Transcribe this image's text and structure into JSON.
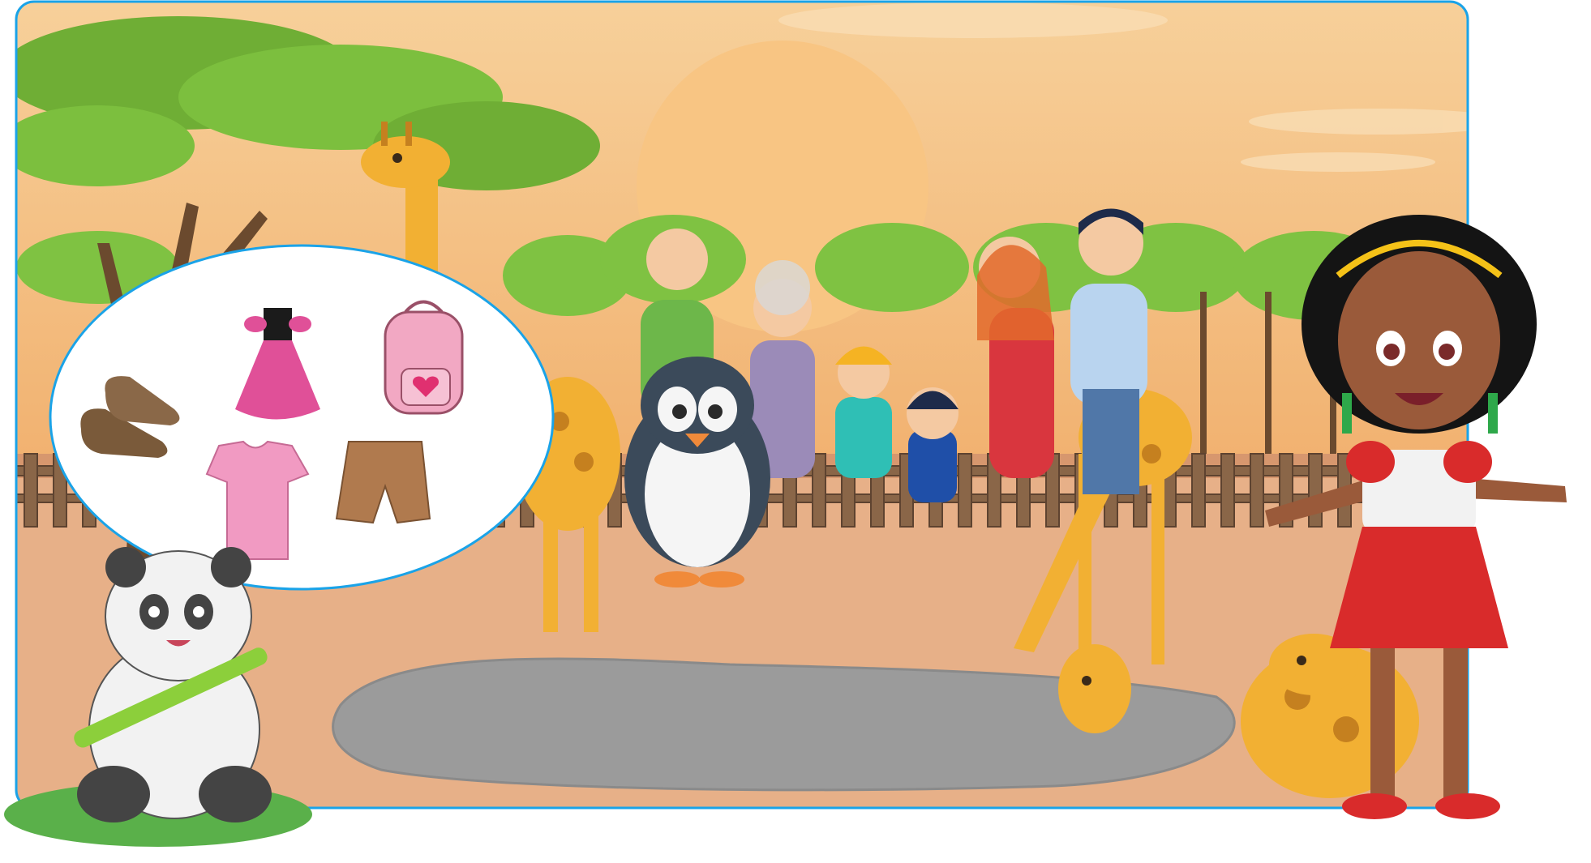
{
  "scene": {
    "palette": {
      "sky_top": "#f6c98e",
      "sky_bottom": "#f0a766",
      "sun": "#f7bf78",
      "frame_border": "#1aa3e8",
      "ground": "#e8b288",
      "pond": "#9a9a9a",
      "fence": "#8a6648",
      "tree_green": "#7cbf3e",
      "tree_trunk": "#6b4a2e",
      "giraffe": "#f2b033",
      "giraffe_spot": "#c5801f"
    }
  },
  "clothing_panel": {
    "items": [
      {
        "name": "shoes-icon"
      },
      {
        "name": "dress-icon"
      },
      {
        "name": "backpack-icon"
      },
      {
        "name": "tshirt-icon"
      },
      {
        "name": "shorts-icon"
      }
    ]
  },
  "characters": [
    {
      "name": "girl"
    },
    {
      "name": "penguin"
    },
    {
      "name": "panda"
    },
    {
      "name": "family"
    },
    {
      "name": "giraffe"
    }
  ]
}
